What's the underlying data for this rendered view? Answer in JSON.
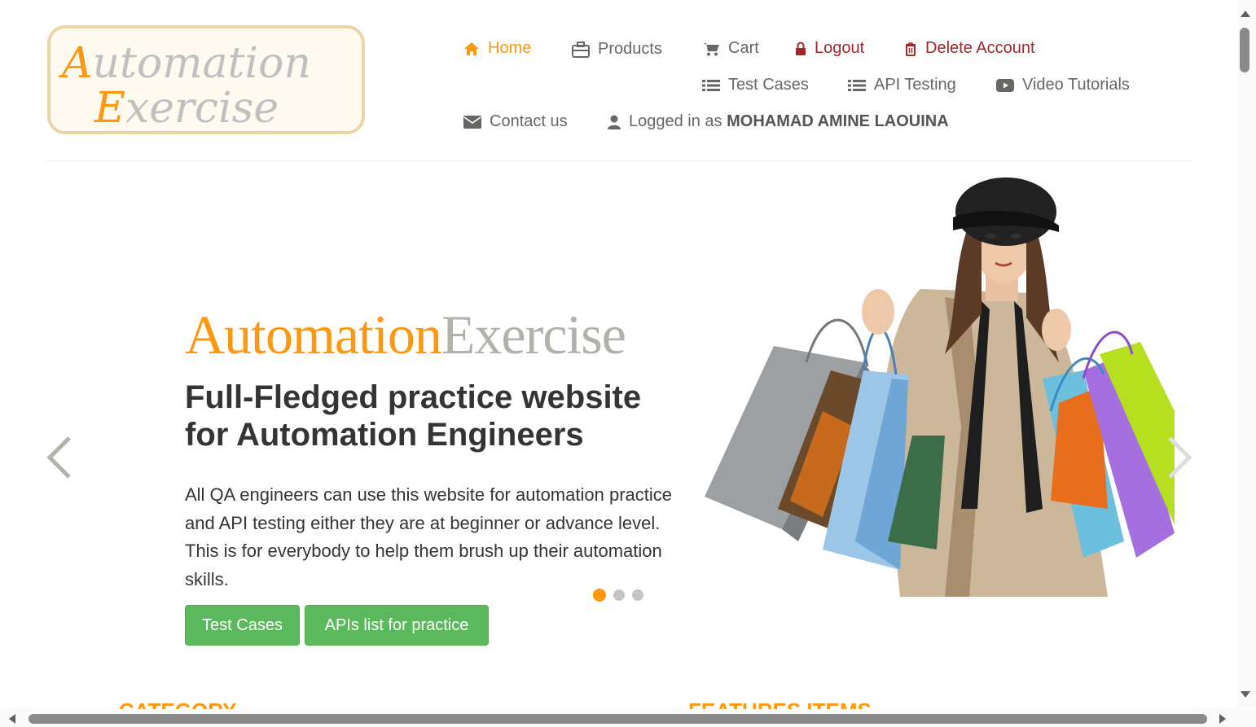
{
  "logo": {
    "line1": "Automation",
    "line2": "Exercise"
  },
  "nav": {
    "home": "Home",
    "products": "Products",
    "cart": "Cart",
    "logout": "Logout",
    "delete_account": "Delete Account",
    "test_cases": "Test Cases",
    "api_testing": "API Testing",
    "video_tutorials": "Video Tutorials",
    "contact_us": "Contact us",
    "logged_in_prefix": "Logged in as",
    "username": "MOHAMAD AMINE LAOUINA"
  },
  "hero": {
    "brand_part1": "Automation",
    "brand_part2": "Exercise",
    "headline_line1": "Full-Fledged practice website",
    "headline_line2": "for Automation Engineers",
    "description": "All QA engineers can use this website for automation practice and API testing either they are at beginner or advance level. This is for everybody to help them brush up their automation skills.",
    "btn_test_cases": "Test Cases",
    "btn_apis": "APIs list for practice",
    "slides_total": 3,
    "active_slide": 1
  },
  "sections": {
    "left_title": "CATEGORY",
    "right_title": "FEATURES ITEMS"
  },
  "colors": {
    "accent": "#FE980F",
    "danger": "#a1262b",
    "button": "#5cb85c",
    "text": "#696763",
    "heading": "#363432"
  }
}
